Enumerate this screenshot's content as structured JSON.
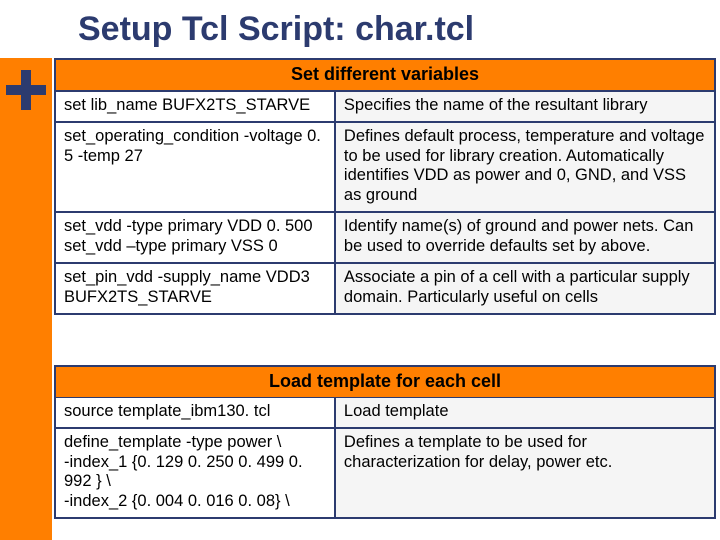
{
  "title": "Setup Tcl Script: char.tcl",
  "sections": [
    {
      "header": "Set different variables",
      "rows": [
        {
          "cmd": "set lib_name BUFX2TS_STARVE",
          "desc": "Specifies the name of the resultant library"
        },
        {
          "cmd": "set_operating_condition -voltage 0. 5 -temp 27",
          "desc": "Defines default process, temperature and voltage to be used for library creation. Automatically identifies VDD as power and 0, GND, and VSS as ground"
        },
        {
          "cmd": "set_vdd -type primary VDD 0. 500\nset_vdd –type primary VSS 0",
          "desc": "Identify name(s) of ground and power nets. Can be used to override defaults set by above."
        },
        {
          "cmd": "set_pin_vdd -supply_name VDD3  BUFX2TS_STARVE",
          "desc": "Associate a pin of a cell with a particular supply domain. Particularly useful on cells"
        }
      ]
    },
    {
      "header": "Load template for each cell",
      "rows": [
        {
          "cmd": "source template_ibm130. tcl",
          "desc": "Load template"
        },
        {
          "cmd": "define_template -type power \\\n  -index_1 {0. 129 0. 250 0. 499 0. 992 } \\\n  -index_2              {0. 004 0. 016 0. 08} \\",
          "desc": "Defines a template to be used for characterization for delay, power etc."
        }
      ]
    }
  ]
}
